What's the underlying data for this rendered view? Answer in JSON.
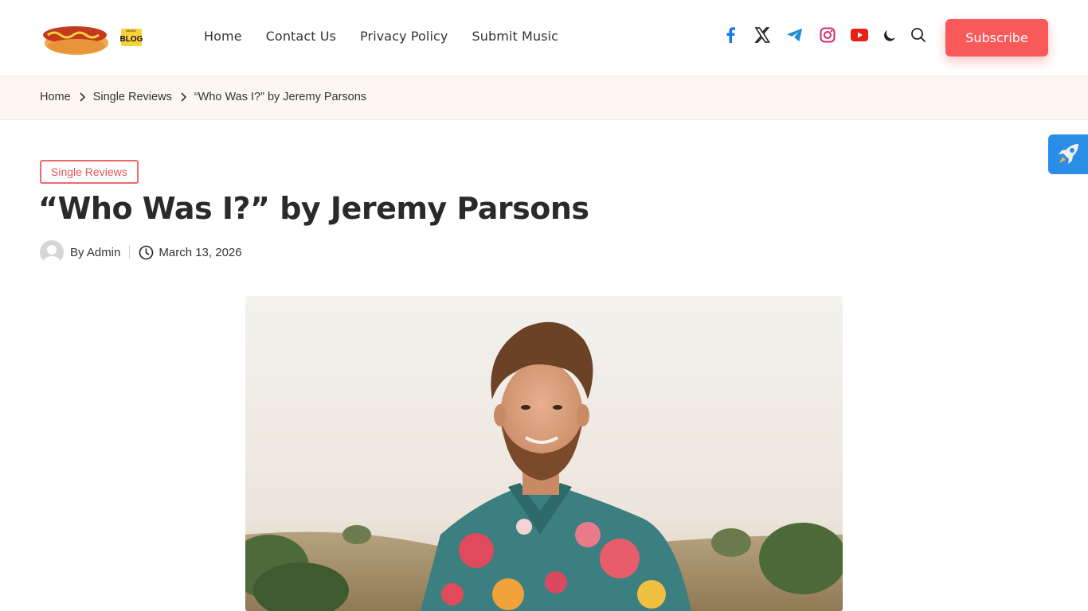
{
  "logo": {
    "brand_text": "BLOG",
    "small_text": "MUSIC"
  },
  "nav": {
    "items": [
      "Home",
      "Contact Us",
      "Privacy Policy",
      "Submit Music"
    ]
  },
  "header": {
    "socials": [
      "facebook-icon",
      "x-icon",
      "telegram-icon",
      "instagram-icon",
      "youtube-icon"
    ],
    "subscribe_label": "Subscribe"
  },
  "breadcrumb": {
    "items": [
      "Home",
      "Single Reviews",
      "“Who Was I?” by Jeremy Parsons"
    ]
  },
  "article": {
    "category": "Single Reviews",
    "title": "“Who Was I?” by Jeremy Parsons",
    "author": "By Admin",
    "date": "March 13, 2026"
  },
  "colors": {
    "accent": "#f85a5a",
    "breadcrumb_bg": "#fcf7f2",
    "rocket_bg": "#2a8ee8"
  }
}
